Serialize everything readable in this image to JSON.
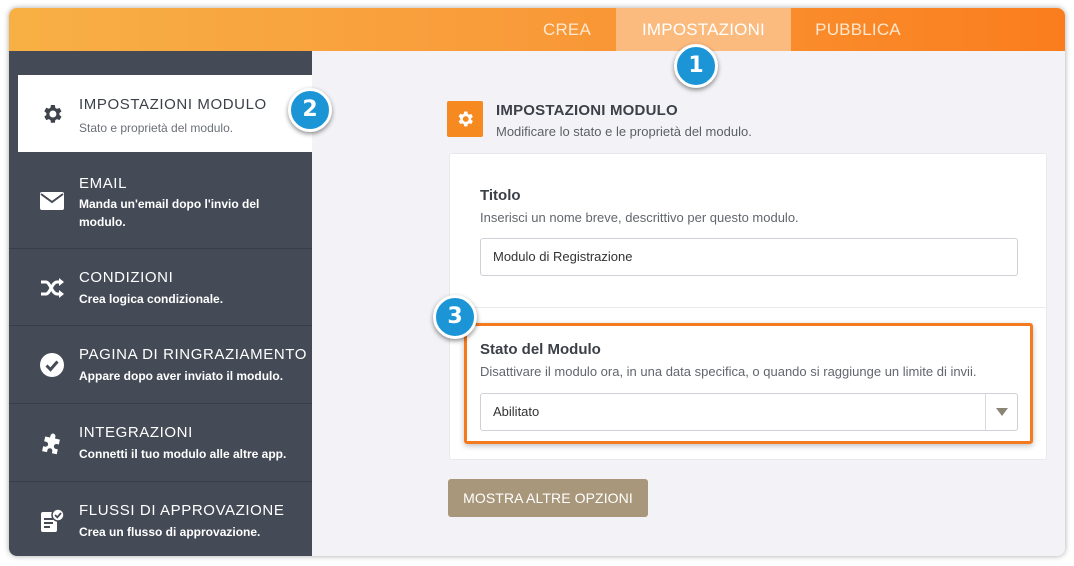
{
  "nav": {
    "tabs": [
      {
        "label": "CREA"
      },
      {
        "label": "IMPOSTAZIONI"
      },
      {
        "label": "PUBBLICA"
      }
    ]
  },
  "badges": [
    "1",
    "2",
    "3"
  ],
  "sidebar": {
    "items": [
      {
        "title": "IMPOSTAZIONI MODULO",
        "desc": "Stato e proprietà del modulo.",
        "icon": "gear-icon"
      },
      {
        "title": "EMAIL",
        "desc": "Manda un'email dopo l'invio del modulo.",
        "icon": "envelope-icon"
      },
      {
        "title": "CONDIZIONI",
        "desc": "Crea logica condizionale.",
        "icon": "shuffle-icon"
      },
      {
        "title": "PAGINA DI RINGRAZIAMENTO",
        "desc": "Appare dopo aver inviato il modulo.",
        "icon": "check-circle-icon"
      },
      {
        "title": "INTEGRAZIONI",
        "desc": "Connetti il tuo modulo alle altre app.",
        "icon": "puzzle-icon"
      },
      {
        "title": "FLUSSI DI APPROVAZIONE",
        "desc": "Crea un flusso di approvazione.",
        "icon": "approval-doc-icon"
      }
    ]
  },
  "main": {
    "header": {
      "title": "IMPOSTAZIONI MODULO",
      "desc": "Modificare lo stato e le proprietà del modulo."
    },
    "title_field": {
      "label": "Titolo",
      "desc": "Inserisci un nome breve, descrittivo per questo modulo.",
      "value": "Modulo di Registrazione"
    },
    "status_field": {
      "label": "Stato del Modulo",
      "desc": "Disattivare il modulo ora, in una data specifica, o quando si raggiunge un limite di invii.",
      "value": "Abilitato"
    },
    "more_button": "MOSTRA ALTRE OPZIONI"
  },
  "colors": {
    "accent": "#f6891f",
    "sidebar": "#454b56",
    "badge": "#1b95d6",
    "button": "#a8977a"
  }
}
